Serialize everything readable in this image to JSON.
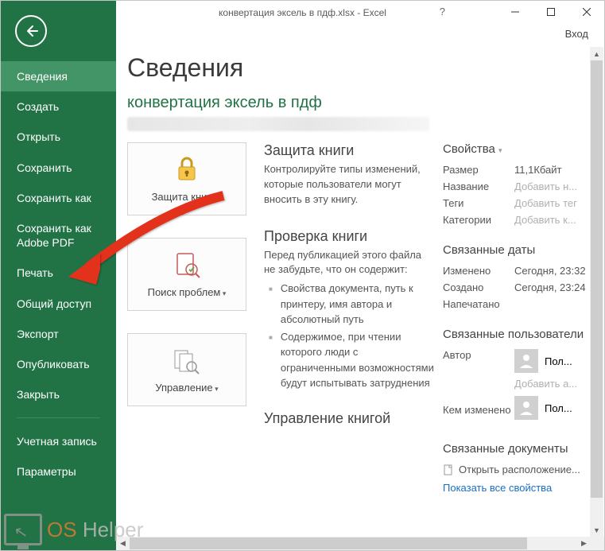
{
  "window": {
    "title": "конвертация эксель в пдф.xlsx - Excel",
    "help": "?",
    "login": "Вход"
  },
  "sidebar": {
    "items": [
      {
        "label": "Сведения",
        "active": true
      },
      {
        "label": "Создать"
      },
      {
        "label": "Открыть"
      },
      {
        "label": "Сохранить"
      },
      {
        "label": "Сохранить как"
      },
      {
        "label": "Сохранить как Adobe PDF"
      },
      {
        "label": "Печать"
      },
      {
        "label": "Общий доступ"
      },
      {
        "label": "Экспорт"
      },
      {
        "label": "Опубликовать"
      },
      {
        "label": "Закрыть"
      }
    ],
    "bottom": [
      {
        "label": "Учетная запись"
      },
      {
        "label": "Параметры"
      }
    ]
  },
  "page": {
    "h1": "Сведения",
    "h2": "конвертация эксель в пдф",
    "sections": [
      {
        "button": "Защита книги",
        "title": "Защита книги",
        "body": "Контролируйте типы изменений, которые пользователи могут вносить в эту книгу."
      },
      {
        "button": "Поиск проблем",
        "title": "Проверка книги",
        "body": "Перед публикацией этого файла не забудьте, что он содержит:",
        "bullets": [
          "Свойства документа, путь к принтеру, имя автора и абсолютный путь",
          "Содержимое, при чтении которого люди с ограниченными возможностями будут испытывать затруднения"
        ]
      },
      {
        "button": "Управление",
        "title": "Управление книгой"
      }
    ],
    "props": {
      "title": "Свойства",
      "rows": [
        {
          "k": "Размер",
          "v": "11,1Кбайт"
        },
        {
          "k": "Название",
          "v": "Добавить н...",
          "ph": true
        },
        {
          "k": "Теги",
          "v": "Добавить тег",
          "ph": true
        },
        {
          "k": "Категории",
          "v": "Добавить к...",
          "ph": true
        }
      ],
      "dates_title": "Связанные даты",
      "dates": [
        {
          "k": "Изменено",
          "v": "Сегодня, 23:32"
        },
        {
          "k": "Создано",
          "v": "Сегодня, 23:24"
        },
        {
          "k": "Напечатано",
          "v": ""
        }
      ],
      "users_title": "Связанные пользователи",
      "author_k": "Автор",
      "author_v": "Пол...",
      "add_author": "Добавить а...",
      "modby_k": "Кем изменено",
      "modby_v": "Пол...",
      "docs_title": "Связанные документы",
      "open_loc": "Открыть расположение...",
      "show_all": "Показать все свойства"
    }
  },
  "watermark": {
    "os": "OS",
    "helper": "Helper"
  }
}
